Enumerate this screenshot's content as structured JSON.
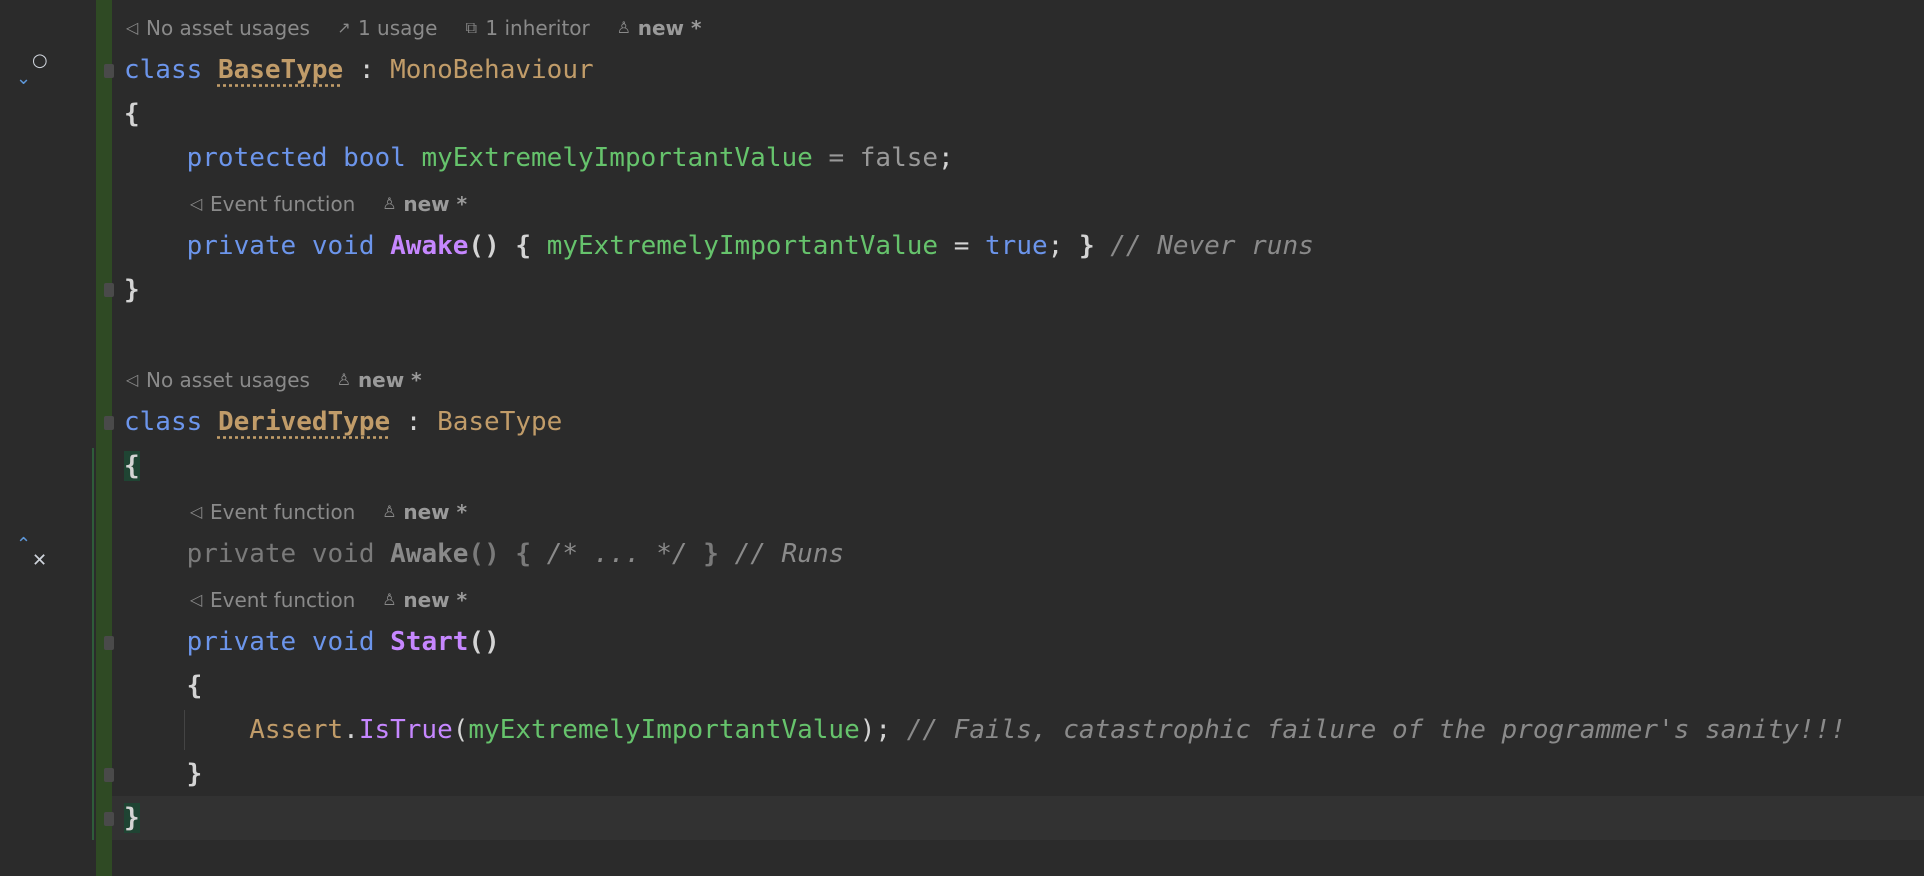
{
  "hints": {
    "h1": {
      "asset": "No asset usages",
      "usage": "1 usage",
      "inheritor": "1 inheritor",
      "author": "new *"
    },
    "h2": {
      "event": "Event function",
      "author": "new *"
    },
    "h3": {
      "asset": "No asset usages",
      "author": "new *"
    },
    "h4": {
      "event": "Event function",
      "author": "new *"
    },
    "h5": {
      "event": "Event function",
      "author": "new *"
    }
  },
  "code": {
    "l1": {
      "kw": "class",
      "name": "BaseType",
      "colon": ":",
      "base": "MonoBehaviour"
    },
    "l2": {
      "brace": "{"
    },
    "l3": {
      "kw1": "protected",
      "kw2": "bool",
      "field": "myExtremelyImportantValue",
      "eq": "=",
      "val": "false",
      "semi": ";"
    },
    "l4": {
      "kw1": "private",
      "kw2": "void",
      "fn": "Awake",
      "parens": "()",
      "ob": "{",
      "field": "myExtremelyImportantValue",
      "eq": "=",
      "val": "true",
      "semi": ";",
      "cb": "}",
      "comment": "// Never runs"
    },
    "l5": {
      "brace": "}"
    },
    "l6": {
      "kw": "class",
      "name": "DerivedType",
      "colon": ":",
      "base": "BaseType"
    },
    "l7": {
      "brace": "{"
    },
    "l8": {
      "kw1": "private",
      "kw2": "void",
      "fn": "Awake",
      "parens": "()",
      "ob": "{",
      "body": "/* ... */",
      "cb": "}",
      "comment": "// Runs"
    },
    "l9": {
      "kw1": "private",
      "kw2": "void",
      "fn": "Start",
      "parens": "()"
    },
    "l10": {
      "brace": "{"
    },
    "l11": {
      "cls": "Assert",
      "dot": ".",
      "fn": "IsTrue",
      "op": "(",
      "field": "myExtremelyImportantValue",
      "cp": ");",
      "comment": "// Fails, catastrophic failure of the programmer's sanity!!!"
    },
    "l12": {
      "brace": "}"
    },
    "l13": {
      "brace": "}"
    }
  },
  "colors": {
    "background": "#2b2b2b",
    "keyword": "#6c95eb",
    "type": "#c19c69",
    "field": "#66c36c",
    "method": "#c687ff",
    "comment": "#8a8a8a",
    "change_bar": "#2f4a24"
  },
  "icons": {
    "unity": "unity-icon",
    "usage": "usage-icon",
    "inheritor": "inheritor-icon",
    "author": "author-icon",
    "implemented": "implemented-icon",
    "overriding": "override-icon"
  }
}
